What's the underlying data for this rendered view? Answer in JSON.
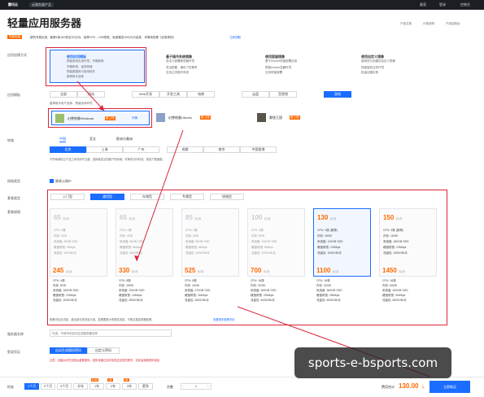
{
  "topbar": {
    "logo": "腾讯云",
    "nav": "云服务器产品",
    "right": [
      "备案",
      "登录",
      "控制台"
    ]
  },
  "header": {
    "title": "轻量应用服务器",
    "links": [
      "产品文档",
      "计费说明",
      "产品控制台"
    ]
  },
  "promo": {
    "badge": "专属优惠",
    "text": "新购专属优惠，套餐4核16G低至30元/月，独享CPU，12M带宽，免费赠送1000元代金券，详情请查看《优惠规则》",
    "link": "立即领取"
  },
  "sections": {
    "creation": "应用创建方式",
    "template": "应用模板",
    "region": "地域",
    "network": "网络类型",
    "package_type": "套餐类型",
    "package_spec": "套餐规格",
    "name": "服务器名称",
    "login": "登录凭证",
    "duration": "时长",
    "quantity": "台数"
  },
  "creation_options": [
    {
      "title": "使用应用模板",
      "desc": "预装常用应用环境，开箱即用",
      "points": [
        "开箱即用，省钱快速",
        "预装数据库与常用软件",
        "推荐新手选择"
      ]
    },
    {
      "title": "基于操作系统镜像",
      "desc": "自定义部署服务器环境",
      "points": [
        "灵活配置，满足个性需求",
        "支持主流操作系统"
      ]
    },
    {
      "title": "使用容器镜像",
      "desc": "基于Docker快速部署应用",
      "points": [
        "预装Docker容器环境",
        "支持快速部署"
      ]
    },
    {
      "title": "使用自定义镜像",
      "desc": "使用您已创建的自定义镜像",
      "points": [
        "快速复制业务环境",
        "批量创建实例"
      ]
    }
  ],
  "template_tabs": [
    "全部",
    "网站",
    "Web开发",
    "开发工具",
    "电商",
    "云盘",
    "音视频",
    "游戏"
  ],
  "template_hint": "推荐新手用户选择，预装游戏环境",
  "templates": [
    {
      "name": "幻兽帕鲁Windows",
      "badge": "新上线",
      "detail": "详情"
    },
    {
      "name": "幻兽帕鲁Ubuntu",
      "badge": "新上线"
    },
    {
      "name": "雾锁王国",
      "badge": "新上线"
    }
  ],
  "region_tabs": [
    "中国",
    "亚太",
    "欧洲与美洲"
  ],
  "regions": [
    "北京",
    "上海",
    "广州",
    "成都",
    "南京",
    "中国香港"
  ],
  "region_note": "不同地域的云产品之间内网不互通，选择最靠近您客户的地域，可降低访问时延、提高下载速度。",
  "network_option": "独享公网IP",
  "package_types": [
    "入门型",
    "通用型",
    "存储型",
    "专属型",
    "锐驰型"
  ],
  "packages": [
    {
      "price": "65",
      "unit": "元/月",
      "specs": [
        "CPU: 2核",
        "内存: 2GB",
        "系统盘: 50GB SSD",
        "峰值带宽: 4Mbps",
        "流量包: 300GB/月"
      ],
      "sold_out": true
    },
    {
      "price": "65",
      "unit": "元/月",
      "specs": [
        "CPU: 2核",
        "内存: 4GB",
        "系统盘: 60GB SSD",
        "峰值带宽: 5Mbps",
        "流量包: 500GB/月"
      ],
      "sold_out": true
    },
    {
      "price": "85",
      "unit": "元/月",
      "specs": [
        "CPU: 2核",
        "内存: 4GB",
        "系统盘: 80GB SSD",
        "峰值带宽: 6Mbps",
        "流量包: 1000GB/月"
      ],
      "sold_out": true
    },
    {
      "price": "100",
      "unit": "元/月",
      "specs": [
        "CPU: 4核",
        "内存: 8GB",
        "系统盘: 100GB SSD",
        "峰值带宽: 8Mbps",
        "流量包: 1200GB/月"
      ],
      "sold_out": true
    },
    {
      "price": "130",
      "unit": "元/月",
      "specs": [
        "CPU: 4核 (推荐)",
        "内存: 16GB",
        "系统盘: 120GB SSD",
        "峰值带宽: 12Mbps",
        "流量包: 1500GB/月"
      ],
      "sold_out": false,
      "selected": true
    },
    {
      "price": "150",
      "unit": "元/月",
      "specs": [
        "CPU: 4核 (推荐)",
        "内存: 16GB",
        "系统盘: 180GB SSD",
        "峰值带宽: 12Mbps",
        "流量包: 1500GB/月"
      ],
      "sold_out": false
    }
  ],
  "packages_row2": [
    {
      "price": "245",
      "unit": "元/月",
      "specs": [
        "CPU: 4核",
        "内存: 8GB",
        "系统盘: 180GB SSD",
        "峰值带宽: 12Mbps",
        "流量包: 2000GB/月"
      ]
    },
    {
      "price": "330",
      "unit": "元/月",
      "specs": [
        "CPU: 8核",
        "内存: 16GB",
        "系统盘: 220GB SSD",
        "峰值带宽: 14Mbps",
        "流量包: 2500GB/月"
      ]
    },
    {
      "price": "525",
      "unit": "元/月",
      "specs": [
        "CPU: 8核",
        "内存: 16GB",
        "系统盘: 270GB SSD",
        "峰值带宽: 16Mbps",
        "流量包: 3500GB/月"
      ]
    },
    {
      "price": "700",
      "unit": "元/月",
      "specs": [
        "CPU: 16核",
        "内存: 32GB",
        "系统盘: 300GB SSD",
        "峰值带宽: 20Mbps",
        "流量包: 4000GB/月"
      ]
    },
    {
      "price": "1100",
      "unit": "元/月",
      "specs": [
        "CPU: 16核",
        "内存: 32GB",
        "系统盘: 360GB SSD",
        "峰值带宽: 28Mbps",
        "流量包: 6000GB/月"
      ]
    },
    {
      "price": "1450",
      "unit": "元/月",
      "specs": [
        "CPU: 16核",
        "内存: 64GB",
        "系统盘: 400GB SSD",
        "峰值带宽: 30Mbps",
        "流量包: 8000GB/月"
      ]
    }
  ],
  "package_note": "套餐内包含流量，超出部分按流量计费。若需要更大带宽或流量，可购买更高规格套餐。",
  "package_note_link": "查看更多套餐详情",
  "name_placeholder": "可选，不填写则自动生成服务器名称",
  "login_options": [
    "自动生成随机密码",
    "自定义密码"
  ],
  "login_warn": "注意：创建后可在控制台重置密码，密码将通过站内信发送至您的账号，请妥善保管密码信息",
  "durations": [
    "1个月",
    "2个月",
    "3个月",
    "半年",
    "1年",
    "2年",
    "3年",
    "更多"
  ],
  "duration_badges": [
    "",
    "",
    "",
    "",
    "8.5折",
    "7折",
    "5折",
    ""
  ],
  "quantity": "1",
  "footer": {
    "fee_label": "费用合计",
    "fee": "130.00",
    "fee_unit": "元",
    "buy": "立即购买"
  },
  "watermark": "sports-e-bsports.com",
  "colors": {
    "accent": "#1a6dff",
    "price": "#ff6a00",
    "annotation": "#d9253a"
  }
}
